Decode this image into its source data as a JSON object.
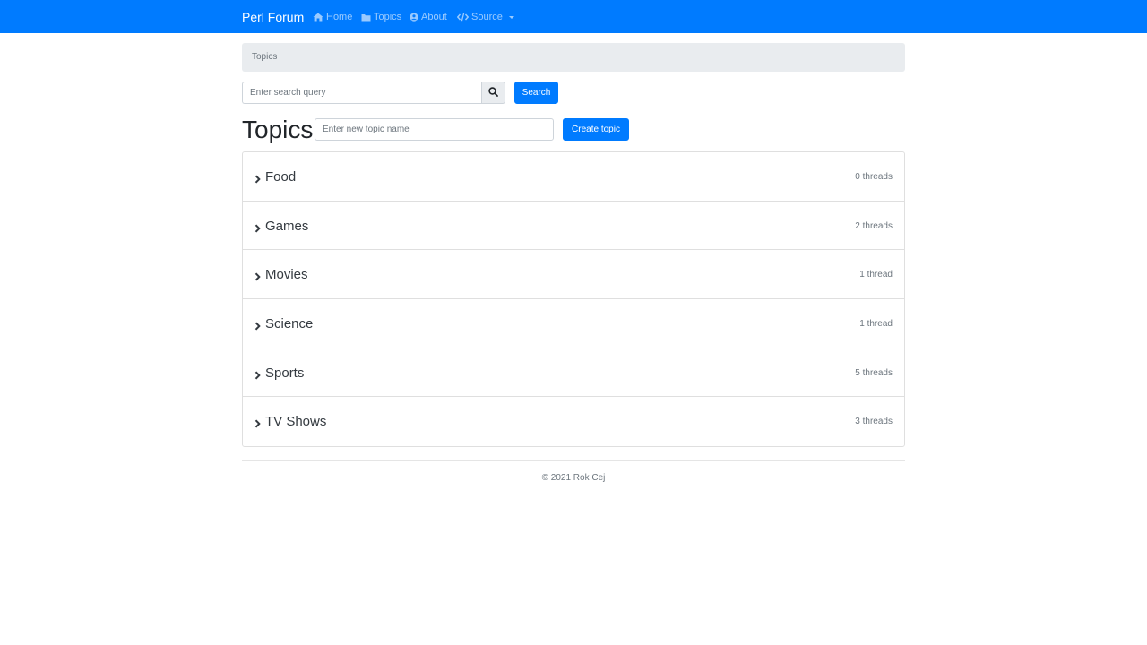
{
  "navbar": {
    "brand": "Perl Forum",
    "links": [
      {
        "label": "Home",
        "icon": "home-icon"
      },
      {
        "label": "Topics",
        "icon": "folder-icon"
      },
      {
        "label": "About",
        "icon": "user-circle-icon"
      },
      {
        "label": "Source",
        "icon": "code-icon",
        "dropdown": true
      }
    ],
    "color": "#007bff"
  },
  "breadcrumb": {
    "current": "Topics"
  },
  "search": {
    "placeholder": "Enter search query",
    "button_label": "Search"
  },
  "topics_header": {
    "title": "Topics",
    "new_topic_placeholder": "Enter new topic name",
    "create_button_label": "Create topic"
  },
  "topics": [
    {
      "name": "Food",
      "count_label": "0 threads"
    },
    {
      "name": "Games",
      "count_label": "2 threads"
    },
    {
      "name": "Movies",
      "count_label": "1 thread"
    },
    {
      "name": "Science",
      "count_label": "1 thread"
    },
    {
      "name": "Sports",
      "count_label": "5 threads"
    },
    {
      "name": "TV Shows",
      "count_label": "3 threads"
    }
  ],
  "footer": {
    "text": "© 2021 Rok Cej"
  }
}
